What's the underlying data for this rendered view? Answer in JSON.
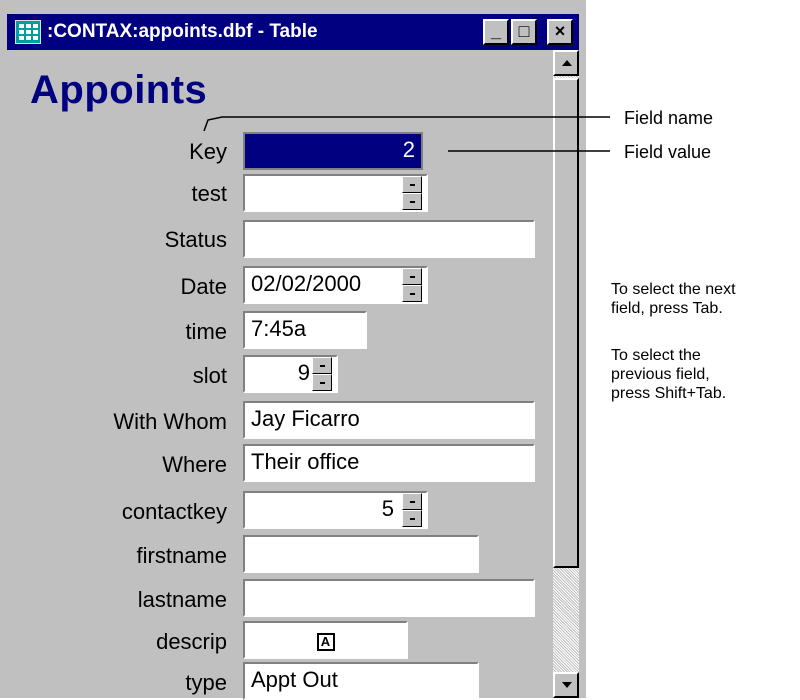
{
  "window": {
    "title": ":CONTAX:appoints.dbf - Table",
    "minimize_glyph": "_",
    "maximize_glyph": "□",
    "close_glyph": "×"
  },
  "form": {
    "title": "Appoints",
    "fields": [
      {
        "label": "Key",
        "value": "2"
      },
      {
        "label": "test",
        "value": ""
      },
      {
        "label": "Status",
        "value": ""
      },
      {
        "label": "Date",
        "value": "02/02/2000"
      },
      {
        "label": "time",
        "value": "7:45a"
      },
      {
        "label": "slot",
        "value": "9"
      },
      {
        "label": "With Whom",
        "value": "Jay Ficarro"
      },
      {
        "label": "Where",
        "value": "Their office"
      },
      {
        "label": "contactkey",
        "value": "5"
      },
      {
        "label": "firstname",
        "value": ""
      },
      {
        "label": "lastname",
        "value": ""
      },
      {
        "label": "descrip",
        "value": ""
      },
      {
        "label": "type",
        "value": "Appt Out"
      }
    ],
    "memo_icon_glyph": "A"
  },
  "annotations": {
    "field_name": "Field name",
    "field_value": "Field value",
    "help_next": "To select the next\nfield, press Tab.",
    "help_prev": "To select the\nprevious field,\npress Shift+Tab."
  },
  "colors": {
    "titlebar": "#000080",
    "window_face": "#c0c0c0",
    "selected_field": "#000080",
    "form_title": "#000080"
  }
}
